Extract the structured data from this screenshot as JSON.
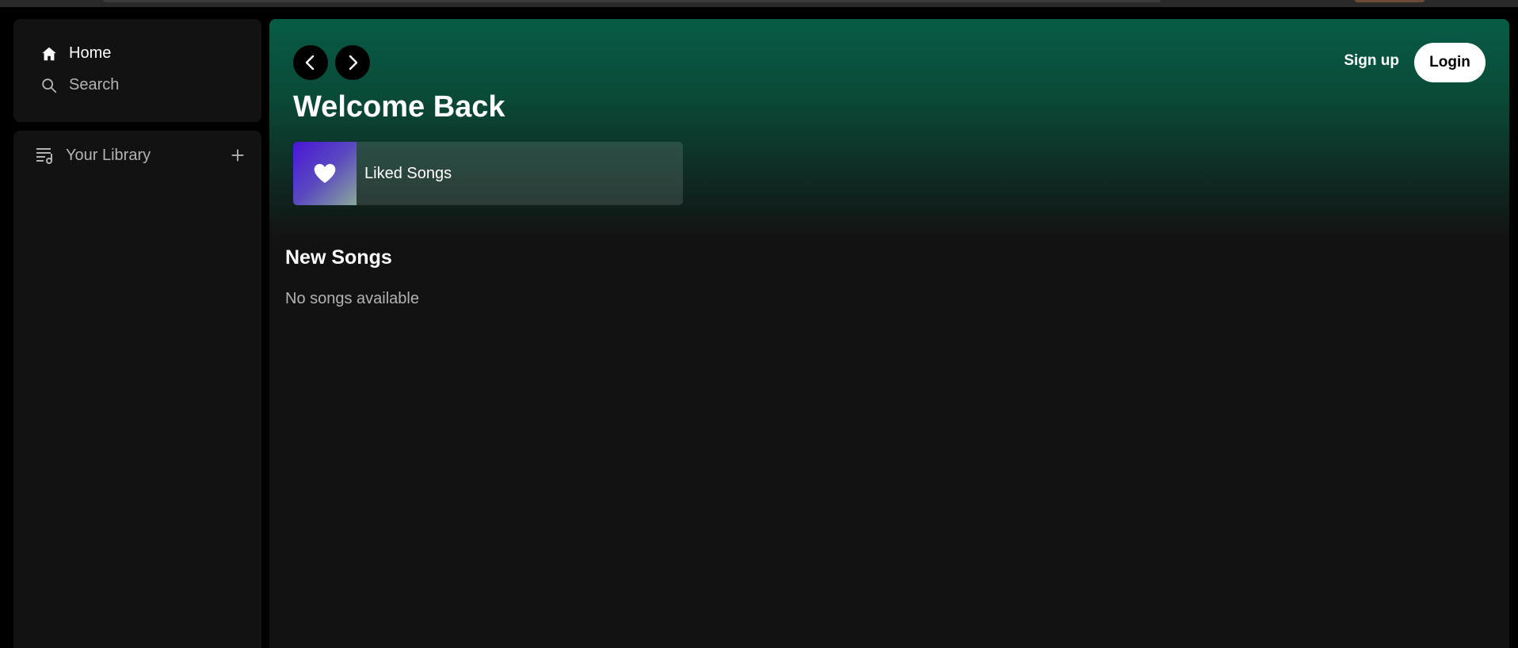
{
  "sidebar": {
    "home_label": "Home",
    "search_label": "Search",
    "library_label": "Your Library"
  },
  "header": {
    "signup_label": "Sign up",
    "login_label": "Login"
  },
  "main": {
    "title": "Welcome Back",
    "liked_songs_label": "Liked Songs",
    "section_title": "New Songs",
    "empty_message": "No songs available"
  },
  "icons": {
    "home": "home-icon",
    "search": "search-icon",
    "library": "library-icon",
    "add": "plus-icon",
    "back": "chevron-left-icon",
    "forward": "chevron-right-icon",
    "heart": "heart-icon"
  },
  "colors": {
    "background": "#000000",
    "panel": "#121212",
    "gradient_top": "#075c46",
    "text_primary": "#ffffff",
    "text_secondary": "#b3b3b3",
    "liked_art_start": "#4a16d6",
    "liked_art_end": "#8aa89a"
  }
}
